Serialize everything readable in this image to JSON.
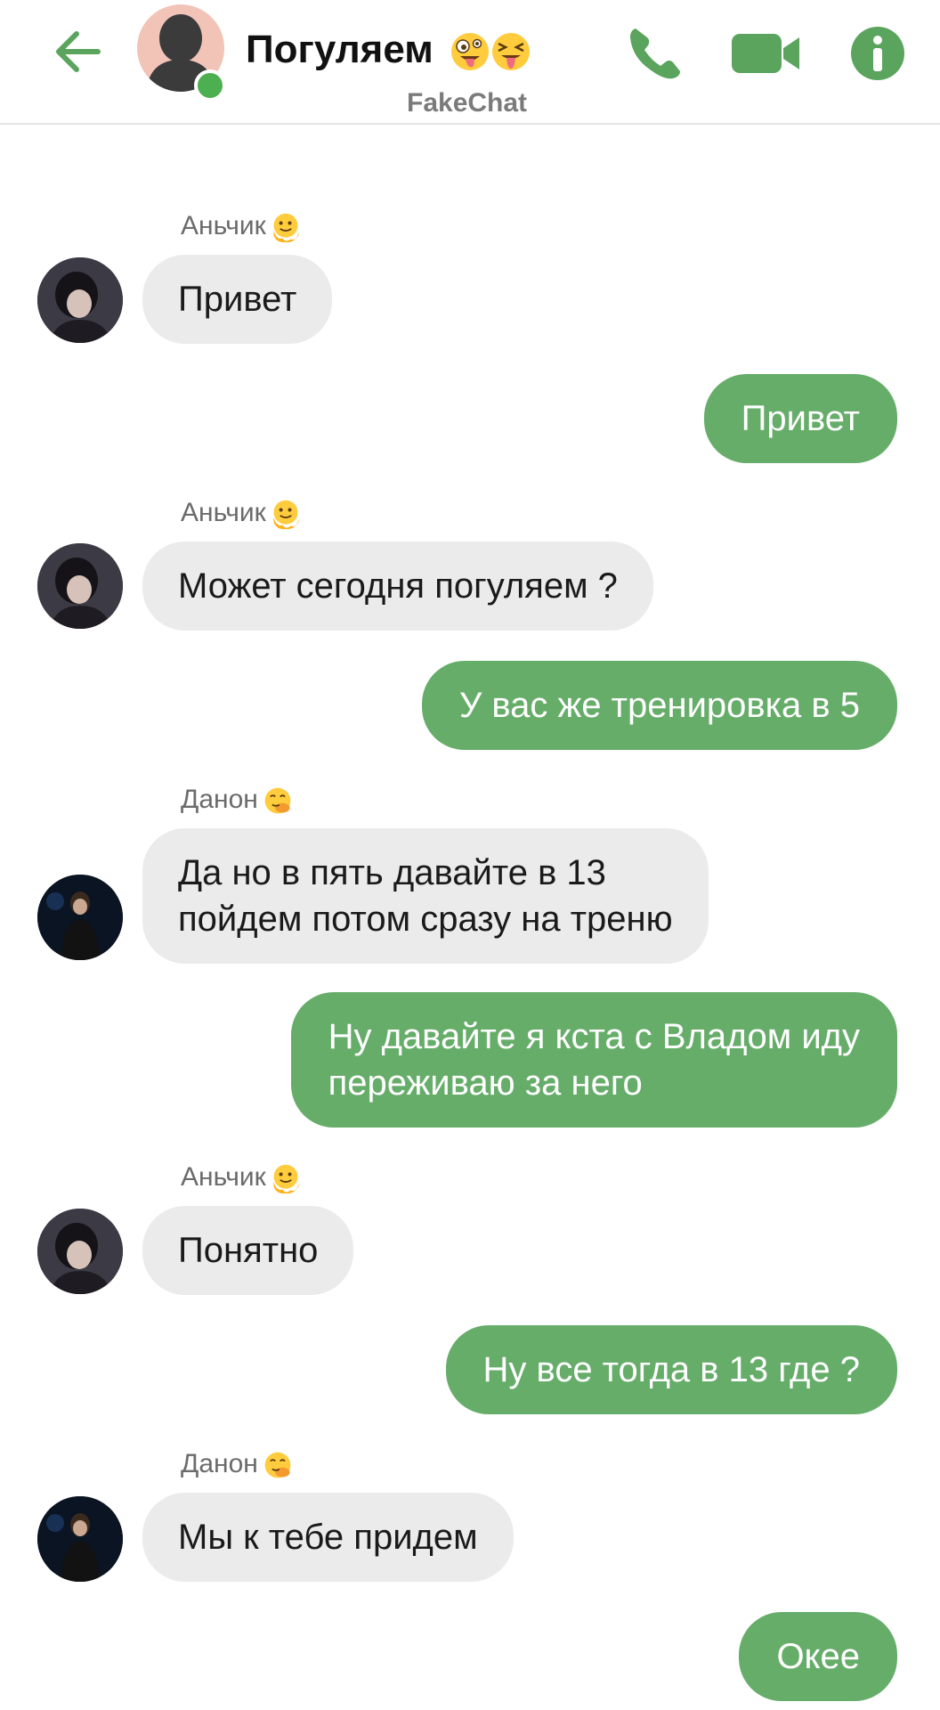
{
  "header": {
    "title": "Погуляем",
    "app_name": "FakeChat"
  },
  "colors": {
    "accent": "#66ad6a",
    "incoming_bubble": "#ebebeb",
    "online": "#4caf50"
  },
  "icons": {
    "back": "arrow-left-icon",
    "call": "phone-icon",
    "video": "video-camera-icon",
    "info": "info-icon"
  },
  "messages": [
    {
      "sender": "Аньчик",
      "text": "Привет"
    },
    {
      "text": "Привет"
    },
    {
      "sender": "Аньчик",
      "text": "Может сегодня погуляем ?"
    },
    {
      "text": "У вас же тренировка в 5"
    },
    {
      "sender": "Данон",
      "text": "Да но в пять давайте в 13\nпойдем потом сразу на треню"
    },
    {
      "text": "Ну давайте я кста с Владом иду\nпереживаю за него"
    },
    {
      "sender": "Аньчик",
      "text": "Понятно"
    },
    {
      "text": "Ну все тогда в 13 где ?"
    },
    {
      "sender": "Данон",
      "text": "Мы к тебе придем"
    },
    {
      "text": "Окее"
    }
  ]
}
